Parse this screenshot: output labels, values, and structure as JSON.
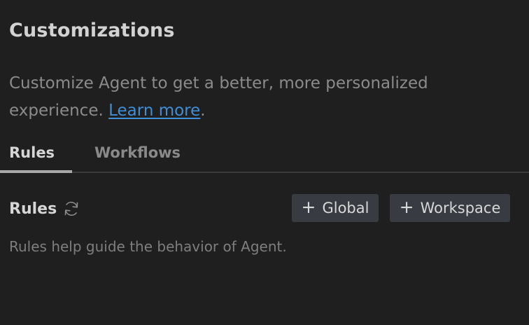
{
  "header": {
    "title": "Customizations",
    "description": "Customize Agent to get a better, more personalized experience.",
    "link_label": "Learn more",
    "link_suffix": ".",
    "link_color": "#3f8fd8"
  },
  "tabs": [
    {
      "label": "Rules",
      "active": true
    },
    {
      "label": "Workflows",
      "active": false
    }
  ],
  "rules_section": {
    "title": "Rules",
    "refresh_icon": "refresh-icon",
    "buttons": {
      "global_label": "Global",
      "workspace_label": "Workspace",
      "plus_glyph": "+"
    },
    "hint": "Rules help guide the behavior of Agent."
  }
}
